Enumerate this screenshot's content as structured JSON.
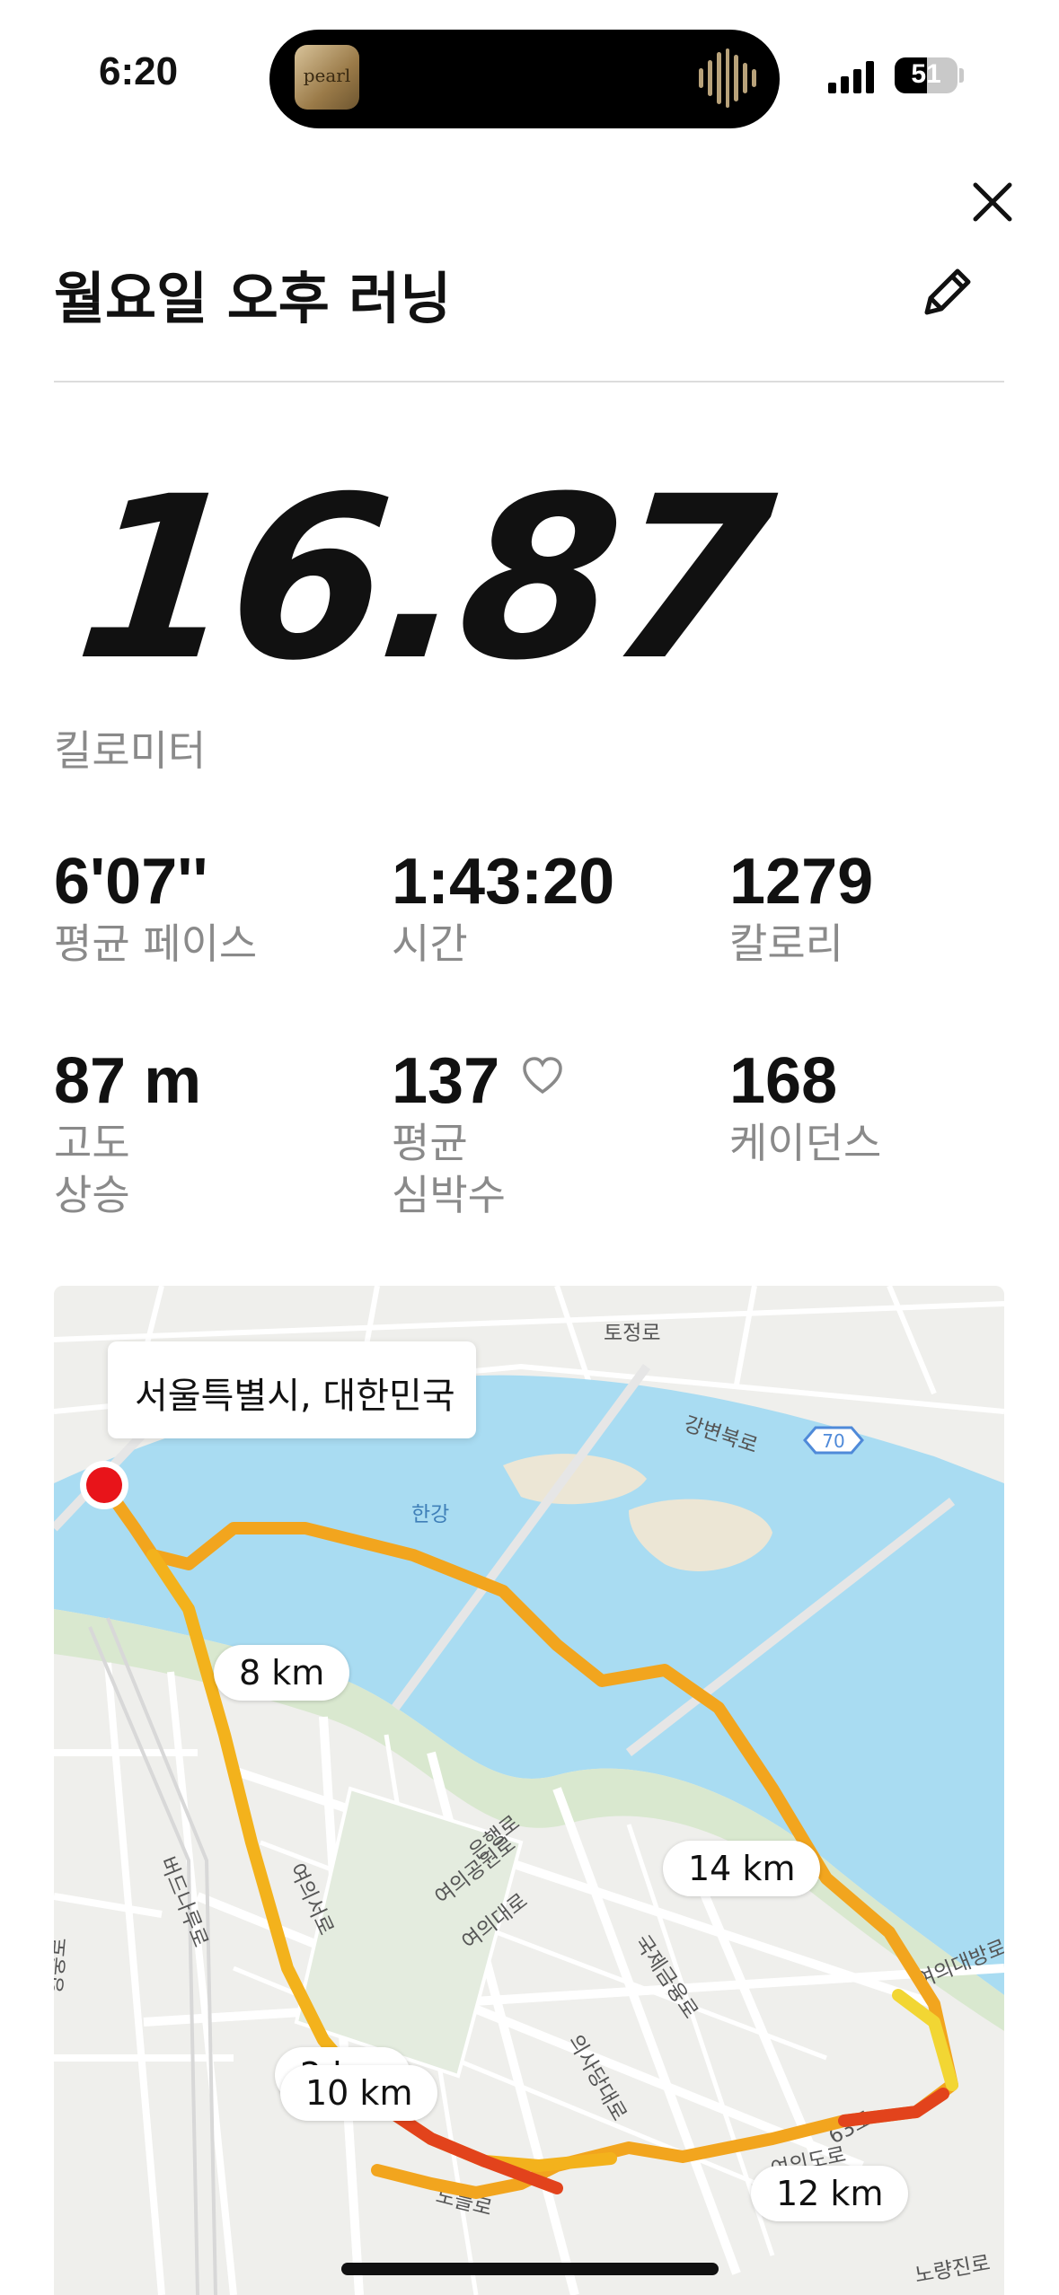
{
  "status_bar": {
    "time": "6:20",
    "island_art_text": "pearl",
    "battery_level": "51",
    "battery_fraction": 0.51
  },
  "header": {
    "title": "월요일 오후 러닝",
    "close_icon": "close-icon",
    "edit_icon": "pencil-icon"
  },
  "summary": {
    "distance": "16.87",
    "distance_unit": "킬로미터"
  },
  "stats": [
    {
      "value": "6'07''",
      "label": "평균 페이스"
    },
    {
      "value": "1:43:20",
      "label": "시간"
    },
    {
      "value": "1279",
      "label": "칼로리"
    },
    {
      "value": "87 m",
      "label_line1": "고도",
      "label_line2": "상승"
    },
    {
      "value": "137",
      "label_line1": "평균",
      "label_line2": "심박수",
      "icon": "heart-icon"
    },
    {
      "value": "168",
      "label": "케이던스"
    }
  ],
  "map": {
    "location": "서울특별시, 대한민국",
    "road_labels": [
      "토정로",
      "강변북로",
      "한강",
      "은행로",
      "여의공원로",
      "여의대로",
      "국제금융로",
      "의사당대로",
      "여의서로",
      "버드나루로",
      "63로",
      "노들로",
      "여의대방로",
      "영중로",
      "노량진로",
      "여의도로"
    ],
    "highway_badge": "70",
    "km_markers": [
      "8 km",
      "14 km",
      "2 km",
      "10 km",
      "12 km"
    ],
    "colors": {
      "water": "#a9dcf2",
      "route_orange": "#f2a51e",
      "route_red": "#e2431c",
      "start": "#e8141a"
    }
  }
}
